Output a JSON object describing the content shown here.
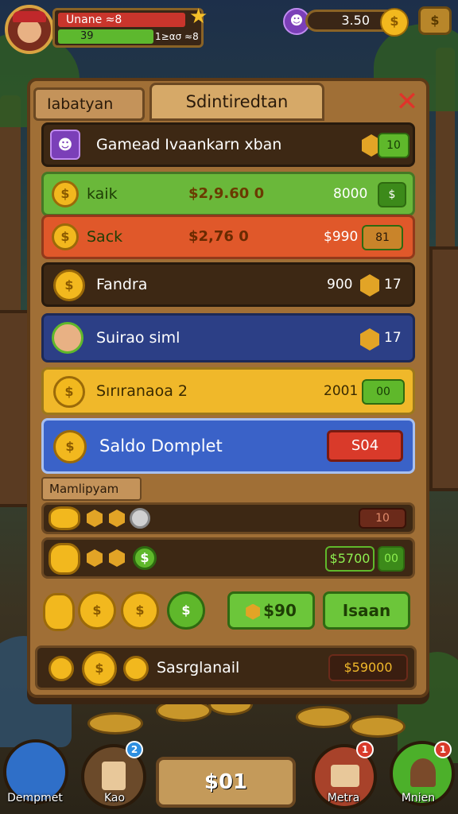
{
  "hud": {
    "player_name": "Unane ≈8",
    "xp_value": "39",
    "xp_secondary": "1≥ασ ≈8",
    "gold_amount": "3.50"
  },
  "panel": {
    "tab_label": "Iabatyan",
    "title": "Sdintiredtan",
    "rows": [
      {
        "label": "Gamead Ivaankarn xban",
        "badge_value": "10"
      },
      {
        "label": "kaik",
        "amount": "$2,9.60 0",
        "value": "8000"
      },
      {
        "label": "Sack",
        "amount": "$2,76 0",
        "value": "$990",
        "badge_value": "81"
      },
      {
        "label": "Fandra",
        "value": "900",
        "badge_value": "17"
      },
      {
        "label": "Suirao siml",
        "badge_value": "17"
      },
      {
        "label": "Sırıranaoa 2",
        "value": "2001",
        "badge_value": "00"
      },
      {
        "label": "Saldo Domplet",
        "button_label": "S04"
      }
    ],
    "section_label": "Mamlipyam",
    "list_rows": [
      {
        "value": "10"
      },
      {
        "value": "$5700",
        "badge_value": "00"
      }
    ],
    "action_gem_label": "$90",
    "action_button_label": "Isaan",
    "footer_label": "Sasrglanail",
    "footer_value": "$59000"
  },
  "bottom_nav": {
    "items": [
      {
        "label": "Dempmet"
      },
      {
        "label": "Kao",
        "badge": "2"
      },
      {
        "label": "Metra",
        "badge": "1"
      },
      {
        "label": "Mnien",
        "badge": "1"
      }
    ],
    "center_value": "$01"
  },
  "colors": {
    "row_green": "#6ab83a",
    "row_orange": "#e0582a",
    "row_blue": "#2c3f86",
    "row_yellow": "#f0b82a",
    "row_lightblue": "#3a62c8"
  }
}
